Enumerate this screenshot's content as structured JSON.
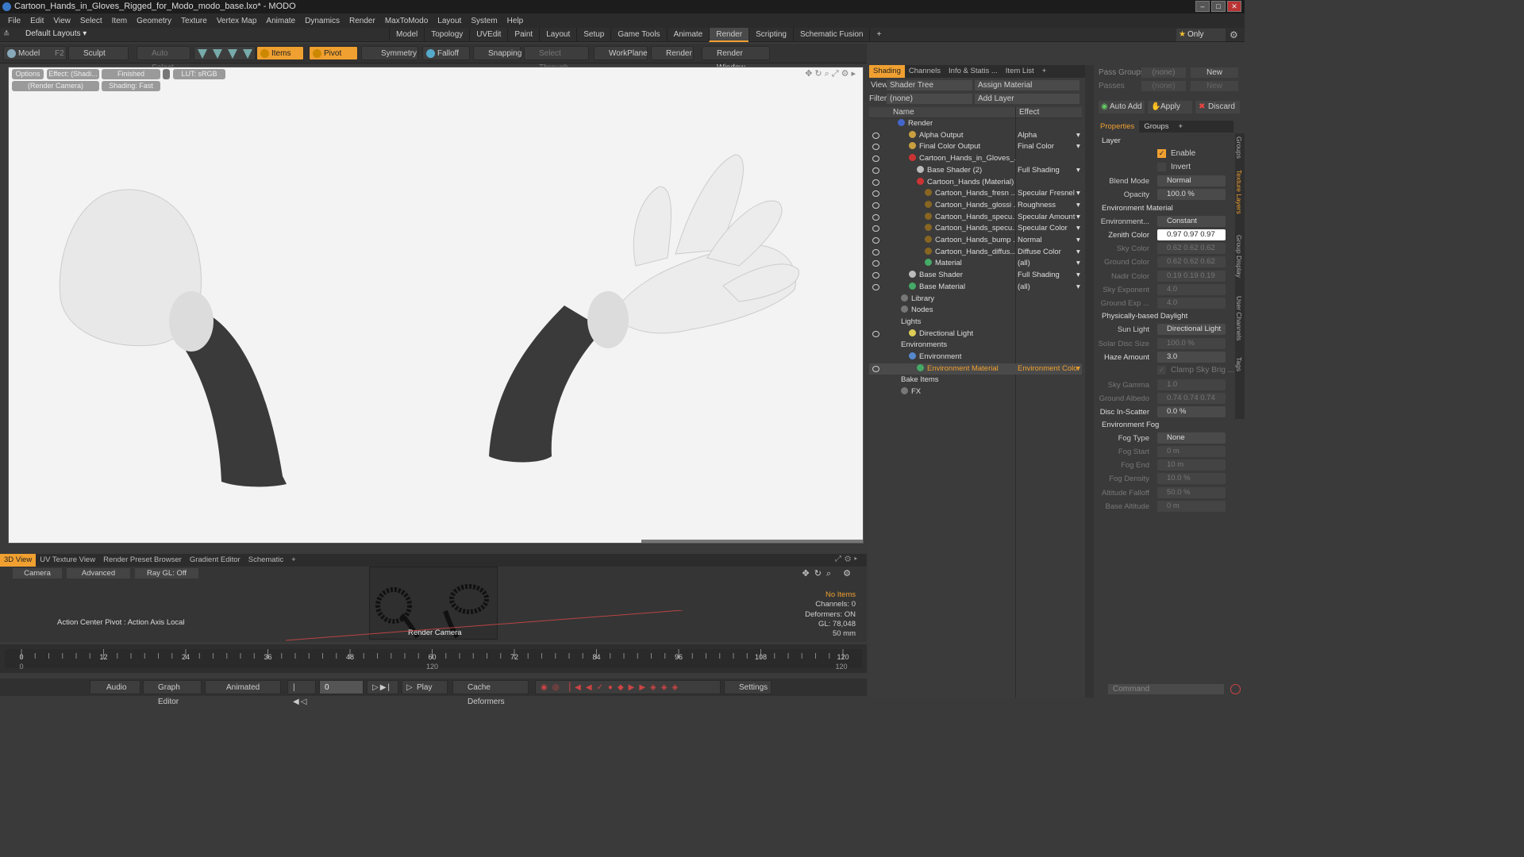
{
  "window": {
    "title": "Cartoon_Hands_in_Gloves_Rigged_for_Modo_modo_base.lxo* - MODO"
  },
  "menu": [
    "File",
    "Edit",
    "View",
    "Select",
    "Item",
    "Geometry",
    "Texture",
    "Vertex Map",
    "Animate",
    "Dynamics",
    "Render",
    "MaxToModo",
    "Layout",
    "System",
    "Help"
  ],
  "layout": {
    "name": "Default Layouts ▾",
    "only": "Only"
  },
  "tabs": [
    "Model",
    "Topology",
    "UVEdit",
    "Paint",
    "Layout",
    "Setup",
    "Game Tools",
    "Animate",
    "Render",
    "Scripting",
    "Schematic Fusion",
    "+"
  ],
  "toolbar": {
    "model": "Model",
    "f2": "F2",
    "sculpt": "Sculpt",
    "auto_select": "Auto Select",
    "items": "Items",
    "pivot": "Pivot",
    "symmetry": "Symmetry",
    "falloff": "Falloff",
    "snapping": "Snapping",
    "select_through": "Select Through",
    "workplane": "WorkPlane",
    "render": "Render",
    "render_window": "Render Window"
  },
  "viewport": {
    "options": "Options",
    "effect": "Effect: (Shadi...",
    "finished": "Finished",
    "lut": "LUT: sRGB",
    "camera": "(Render Camera)",
    "shading": "Shading: Fast"
  },
  "viewtabs": [
    "3D View",
    "UV Texture View",
    "Render Preset Browser",
    "Gradient Editor",
    "Schematic",
    "+"
  ],
  "lower": {
    "camera": "Camera",
    "advanced": "Advanced",
    "raygl": "Ray GL: Off",
    "action_center": "Action Center Pivot : Action Axis Local",
    "render_camera": "Render Camera",
    "stats": [
      "No Items",
      "Channels: 0",
      "Deformers: ON",
      "GL: 78,048",
      "50 mm"
    ]
  },
  "timeline": {
    "ticks": [
      "0",
      "12",
      "24",
      "36",
      "48",
      "60",
      "72",
      "84",
      "96",
      "108",
      "120"
    ],
    "sub": [
      "0",
      "120",
      "120"
    ]
  },
  "bottom": {
    "audio": "Audio",
    "graph_editor": "Graph Editor",
    "animated": "Animated",
    "frame": "0",
    "play": "Play",
    "cache": "Cache Deformers",
    "settings": "Settings"
  },
  "shading": {
    "tabs": [
      "Shading",
      "Channels",
      "Info & Statis ...",
      "Item List",
      "+"
    ],
    "view_label": "View",
    "view_value": "Shader Tree",
    "assign": "Assign Material",
    "filter_label": "Filter",
    "filter_value": "(none)",
    "add_layer": "Add Layer",
    "col_name": "Name",
    "col_effect": "Effect",
    "rows": [
      {
        "n": "Render",
        "e": "",
        "x": 36,
        "c": "#4466cc",
        "eye": false
      },
      {
        "n": "Alpha Output",
        "e": "Alpha",
        "x": 50,
        "c": "#c9a040",
        "eye": true
      },
      {
        "n": "Final Color Output",
        "e": "Final Color",
        "x": 50,
        "c": "#c9a040",
        "eye": true
      },
      {
        "n": "Cartoon_Hands_in_Gloves_...",
        "e": "",
        "x": 50,
        "c": "#cc3333",
        "eye": true
      },
      {
        "n": "Base Shader (2)",
        "e": "Full Shading",
        "x": 60,
        "c": "#bbbbbb",
        "eye": true
      },
      {
        "n": "Cartoon_Hands (Material)",
        "e": "",
        "x": 60,
        "c": "#cc3333",
        "eye": true
      },
      {
        "n": "Cartoon_Hands_fresn ...",
        "e": "Specular Fresnel",
        "x": 70,
        "c": "#886622",
        "eye": true
      },
      {
        "n": "Cartoon_Hands_glossi ...",
        "e": "Roughness",
        "x": 70,
        "c": "#886622",
        "eye": true
      },
      {
        "n": "Cartoon_Hands_specu...",
        "e": "Specular Amount",
        "x": 70,
        "c": "#886622",
        "eye": true
      },
      {
        "n": "Cartoon_Hands_specu...",
        "e": "Specular Color",
        "x": 70,
        "c": "#886622",
        "eye": true
      },
      {
        "n": "Cartoon_Hands_bump ...",
        "e": "Normal",
        "x": 70,
        "c": "#886622",
        "eye": true
      },
      {
        "n": "Cartoon_Hands_diffus...",
        "e": "Diffuse Color",
        "x": 70,
        "c": "#886622",
        "eye": true
      },
      {
        "n": "Material",
        "e": "(all)",
        "x": 70,
        "c": "#44aa66",
        "eye": true
      },
      {
        "n": "Base Shader",
        "e": "Full Shading",
        "x": 50,
        "c": "#bbbbbb",
        "eye": true
      },
      {
        "n": "Base Material",
        "e": "(all)",
        "x": 50,
        "c": "#44aa66",
        "eye": true
      },
      {
        "n": "Library",
        "e": "",
        "x": 40,
        "c": "#777777",
        "eye": false
      },
      {
        "n": "Nodes",
        "e": "",
        "x": 40,
        "c": "#777777",
        "eye": false
      },
      {
        "n": "Lights",
        "e": "",
        "x": 40,
        "c": "",
        "eye": false
      },
      {
        "n": "Directional Light",
        "e": "",
        "x": 50,
        "c": "#ddcc55",
        "eye": true
      },
      {
        "n": "Environments",
        "e": "",
        "x": 40,
        "c": "",
        "eye": false
      },
      {
        "n": "Environment",
        "e": "",
        "x": 50,
        "c": "#5588cc",
        "eye": false
      },
      {
        "n": "Environment Material",
        "e": "Environment Color",
        "x": 60,
        "c": "#44aa66",
        "eye": true,
        "sel": true
      },
      {
        "n": "Bake Items",
        "e": "",
        "x": 40,
        "c": "",
        "eye": false
      },
      {
        "n": "FX",
        "e": "",
        "x": 40,
        "c": "#777777",
        "eye": false
      }
    ]
  },
  "props": {
    "pass_groups": "Pass Groups",
    "passes": "Passes",
    "none": "(none)",
    "new": "New",
    "auto_add": "Auto Add",
    "apply": "Apply",
    "discard": "Discard",
    "tabs": [
      "Properties",
      "Groups",
      "+"
    ],
    "layer": "Layer",
    "enable": "Enable",
    "invert": "Invert",
    "blend_mode": "Blend Mode",
    "blend_value": "Normal",
    "opacity": "Opacity",
    "opacity_value": "100.0 %",
    "env_material": "Environment Material",
    "environment": "Environment...",
    "env_value": "Constant",
    "fields": [
      {
        "l": "Zenith Color",
        "v": "0.97  0.97  0.97",
        "dim": false,
        "hi": true
      },
      {
        "l": "Sky Color",
        "v": "0.62  0.62  0.62",
        "dim": true
      },
      {
        "l": "Ground Color",
        "v": "0.62  0.62  0.62",
        "dim": true
      },
      {
        "l": "Nadir Color",
        "v": "0.19  0.19  0.19",
        "dim": true
      },
      {
        "l": "Sky Exponent",
        "v": "4.0",
        "dim": true
      },
      {
        "l": "Ground Exp ...",
        "v": "4.0",
        "dim": true
      }
    ],
    "pbd": "Physically-based Daylight",
    "sun_light": "Sun Light",
    "sun_value": "Directional Light",
    "fields2": [
      {
        "l": "Solar Disc Size",
        "v": "100.0 %",
        "dim": true
      },
      {
        "l": "Haze Amount",
        "v": "3.0",
        "dim": false
      }
    ],
    "clamp": "Clamp Sky Brig ...",
    "fields3": [
      {
        "l": "Sky Gamma",
        "v": "1.0",
        "dim": true
      },
      {
        "l": "Ground Albedo",
        "v": "0.74  0.74  0.74",
        "dim": true
      },
      {
        "l": "Disc In-Scatter",
        "v": "0.0 %",
        "dim": false
      }
    ],
    "env_fog": "Environment Fog",
    "fog_type": "Fog Type",
    "fog_value": "None",
    "fields4": [
      {
        "l": "Fog Start",
        "v": "0 m"
      },
      {
        "l": "Fog End",
        "v": "10 m"
      },
      {
        "l": "Fog Density",
        "v": "10.0 %"
      },
      {
        "l": "Altitude Falloff",
        "v": "50.0 %"
      },
      {
        "l": "Base Altitude",
        "v": "0 m"
      }
    ],
    "vtabs": [
      "Groups",
      "Texture Layers",
      "Group Display",
      "User Channels",
      "Tags"
    ],
    "command": "Command"
  }
}
